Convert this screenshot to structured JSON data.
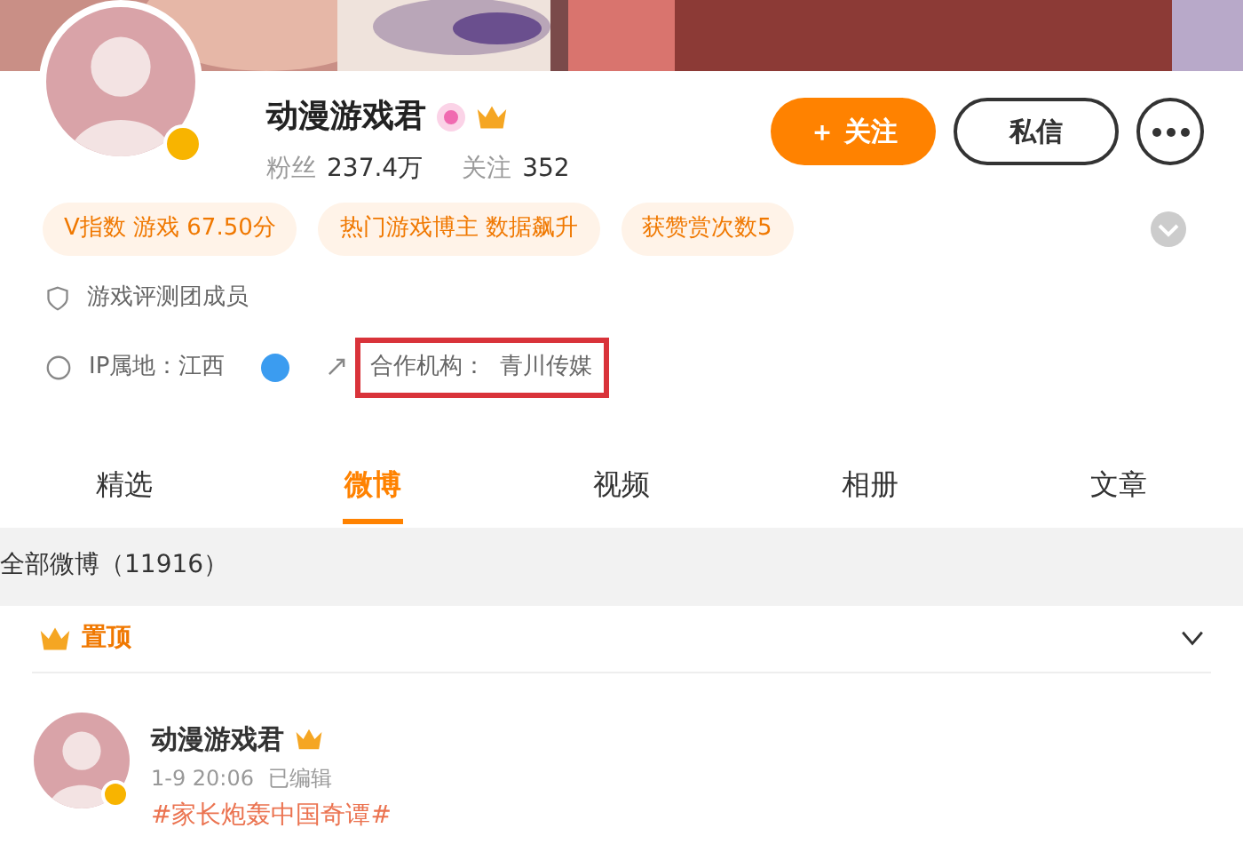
{
  "profile": {
    "name": "动漫游戏君",
    "verified": true,
    "fans_label": "粉丝",
    "fans": "237.4万",
    "following_label": "关注",
    "following": "352",
    "follow_button": "＋ 关注",
    "message_button": "私信"
  },
  "tags": [
    "V指数 游戏 67.50分",
    "热门游戏博主 数据飙升",
    "获赞赏次数5"
  ],
  "info": {
    "member": "游戏评测团成员",
    "ip": "IP属地：江西",
    "agency_label": "合作机构：",
    "agency": "青川传媒",
    "agency_highlighted": true
  },
  "tabs": [
    {
      "label": "精选",
      "selected": false
    },
    {
      "label": "微博",
      "selected": true
    },
    {
      "label": "视频",
      "selected": false
    },
    {
      "label": "相册",
      "selected": false
    },
    {
      "label": "文章",
      "selected": false
    }
  ],
  "all_posts": "全部微博（11916）",
  "pinned": {
    "label": "置顶",
    "expanded": false
  },
  "post": {
    "author": "动漫游戏君",
    "verified": true,
    "time": "1-9 20:06",
    "edited": "已编辑",
    "text": "#家长炮轰中国奇谭#"
  }
}
